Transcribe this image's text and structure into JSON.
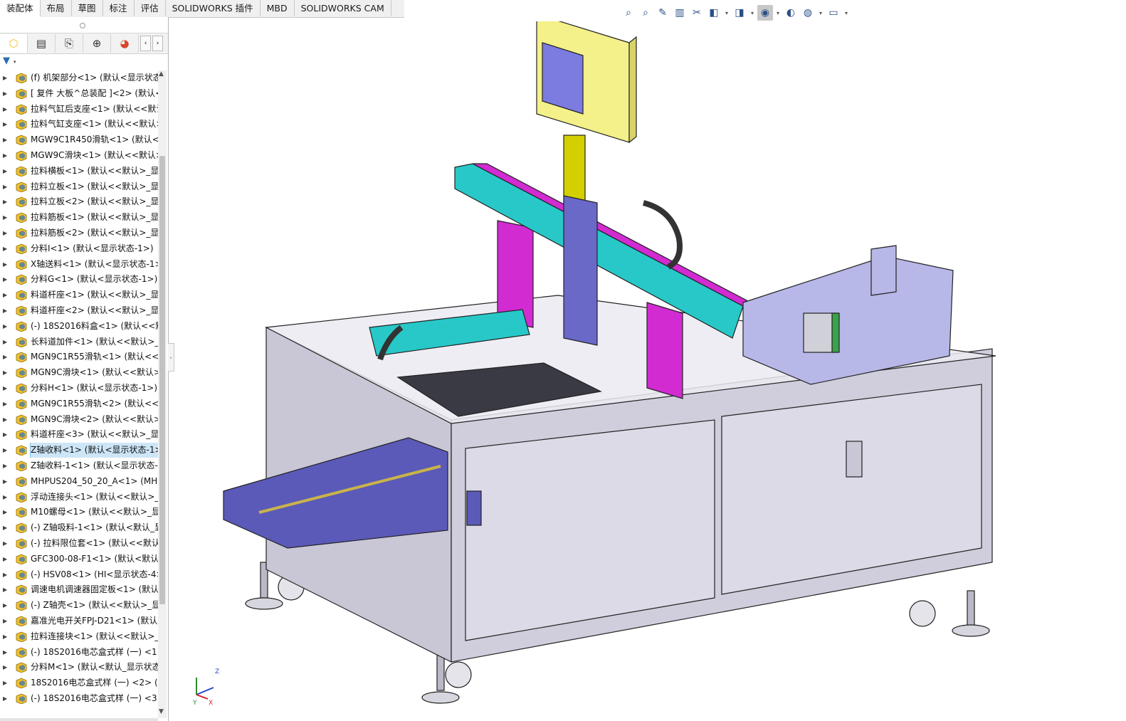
{
  "command_tabs": [
    {
      "label": "装配体",
      "active": true
    },
    {
      "label": "布局",
      "active": false
    },
    {
      "label": "草图",
      "active": false
    },
    {
      "label": "标注",
      "active": false
    },
    {
      "label": "评估",
      "active": false
    },
    {
      "label": "SOLIDWORKS 插件",
      "active": false
    },
    {
      "label": "MBD",
      "active": false
    },
    {
      "label": "SOLIDWORKS CAM",
      "active": false
    }
  ],
  "view_toolbar": [
    {
      "icon": "zoom-to-fit-icon",
      "glyph": "⌕"
    },
    {
      "icon": "zoom-to-area-icon",
      "glyph": "⌕"
    },
    {
      "icon": "previous-view-icon",
      "glyph": "✎"
    },
    {
      "icon": "section-view-icon",
      "glyph": "▥"
    },
    {
      "icon": "dynamic-annotation-icon",
      "glyph": "✂"
    },
    {
      "icon": "view-orientation-icon",
      "glyph": "◧"
    },
    {
      "icon": "display-style-icon",
      "glyph": "◨"
    },
    {
      "icon": "hide-show-items-icon",
      "glyph": "◉"
    },
    {
      "icon": "edit-appearance-icon",
      "glyph": "◐"
    },
    {
      "icon": "apply-scene-icon",
      "glyph": "◍"
    },
    {
      "icon": "view-settings-icon",
      "glyph": "▭"
    }
  ],
  "panel_tabs": [
    {
      "icon": "feature-manager-icon",
      "glyph": "⬡"
    },
    {
      "icon": "property-manager-icon",
      "glyph": "▤"
    },
    {
      "icon": "configuration-manager-icon",
      "glyph": "⎘"
    },
    {
      "icon": "dimxpert-manager-icon",
      "glyph": "⊕"
    },
    {
      "icon": "display-manager-icon",
      "glyph": "◕"
    }
  ],
  "colors": {
    "assembly_icon_yellow": "#f2c12e",
    "assembly_icon_blue": "#2f6fb3",
    "selection_bg": "#cde6f7",
    "frame_gray": "#c9c6d6",
    "cyan_module": "#28c8c8",
    "magenta_bracket": "#d22bd2",
    "purple_plate": "#5b5ab8",
    "control_box_yellow": "#f4f08a"
  },
  "tree": [
    {
      "label": "(f) 机架部分<1> (默认<显示状态",
      "selected": false
    },
    {
      "label": "[ 复件 大板^总装配 ]<2> (默认<",
      "selected": false
    },
    {
      "label": "拉料气缸后支座<1> (默认<<默认",
      "selected": false
    },
    {
      "label": "拉料气缸支座<1> (默认<<默认>",
      "selected": false
    },
    {
      "label": "MGW9C1R450滑轨<1> (默认<<",
      "selected": false
    },
    {
      "label": "MGW9C滑块<1> (默认<<默认>",
      "selected": false
    },
    {
      "label": "拉料横板<1> (默认<<默认>_显示",
      "selected": false
    },
    {
      "label": "拉料立板<1> (默认<<默认>_显示",
      "selected": false
    },
    {
      "label": "拉料立板<2> (默认<<默认>_显示",
      "selected": false
    },
    {
      "label": "拉料筋板<1> (默认<<默认>_显示",
      "selected": false
    },
    {
      "label": "拉料筋板<2> (默认<<默认>_显示",
      "selected": false
    },
    {
      "label": "分料I<1> (默认<显示状态-1>)",
      "selected": false
    },
    {
      "label": "X轴送料<1> (默认<显示状态-1>",
      "selected": false
    },
    {
      "label": "分料G<1> (默认<显示状态-1>)",
      "selected": false
    },
    {
      "label": "料道杆座<1> (默认<<默认>_显示",
      "selected": false
    },
    {
      "label": "料道杆座<2> (默认<<默认>_显示",
      "selected": false
    },
    {
      "label": "(-) 18S2016料盒<1> (默认<<默",
      "selected": false
    },
    {
      "label": "长料道加件<1> (默认<<默认>_显",
      "selected": false
    },
    {
      "label": "MGN9C1R55滑轨<1> (默认<<默",
      "selected": false
    },
    {
      "label": "MGN9C滑块<1> (默认<<默认>_",
      "selected": false
    },
    {
      "label": "分料H<1> (默认<显示状态-1>)",
      "selected": false
    },
    {
      "label": "MGN9C1R55滑轨<2> (默认<<默",
      "selected": false
    },
    {
      "label": "MGN9C滑块<2> (默认<<默认>_",
      "selected": false
    },
    {
      "label": "料道杆座<3> (默认<<默认>_显示",
      "selected": false
    },
    {
      "label": "Z轴收料<1> (默认<显示状态-1>",
      "selected": true
    },
    {
      "label": "Z轴收料-1<1> (默认<显示状态-1",
      "selected": false
    },
    {
      "label": "MHPUS204_50_20_A<1> (MHP",
      "selected": false
    },
    {
      "label": "浮动连接头<1> (默认<<默认>_显",
      "selected": false
    },
    {
      "label": "M10螺母<1> (默认<<默认>_显示",
      "selected": false
    },
    {
      "label": "(-) Z轴吸料-1<1> (默认<默认_显",
      "selected": false
    },
    {
      "label": "(-) 拉料限位套<1> (默认<<默认",
      "selected": false
    },
    {
      "label": "GFC300-08-F1<1> (默认<默认_",
      "selected": false
    },
    {
      "label": "(-) HSV08<1> (HI<显示状态-4>",
      "selected": false
    },
    {
      "label": "调速电机调速器固定板<1> (默认",
      "selected": false
    },
    {
      "label": "(-) Z轴壳<1> (默认<<默认>_显示",
      "selected": false
    },
    {
      "label": "嘉准光电开关FPJ-D21<1> (默认",
      "selected": false
    },
    {
      "label": "拉料连接块<1> (默认<<默认>_显",
      "selected": false
    },
    {
      "label": "(-) 18S2016电芯盒式样 (一) <1",
      "selected": false
    },
    {
      "label": "分料M<1> (默认<默认_显示状态",
      "selected": false
    },
    {
      "label": "18S2016电芯盒式样 (一) <2> (",
      "selected": false
    },
    {
      "label": "(-) 18S2016电芯盒式样 (一) <3",
      "selected": false
    }
  ],
  "triad": {
    "z": "Z",
    "x": "X",
    "y": "Y"
  }
}
